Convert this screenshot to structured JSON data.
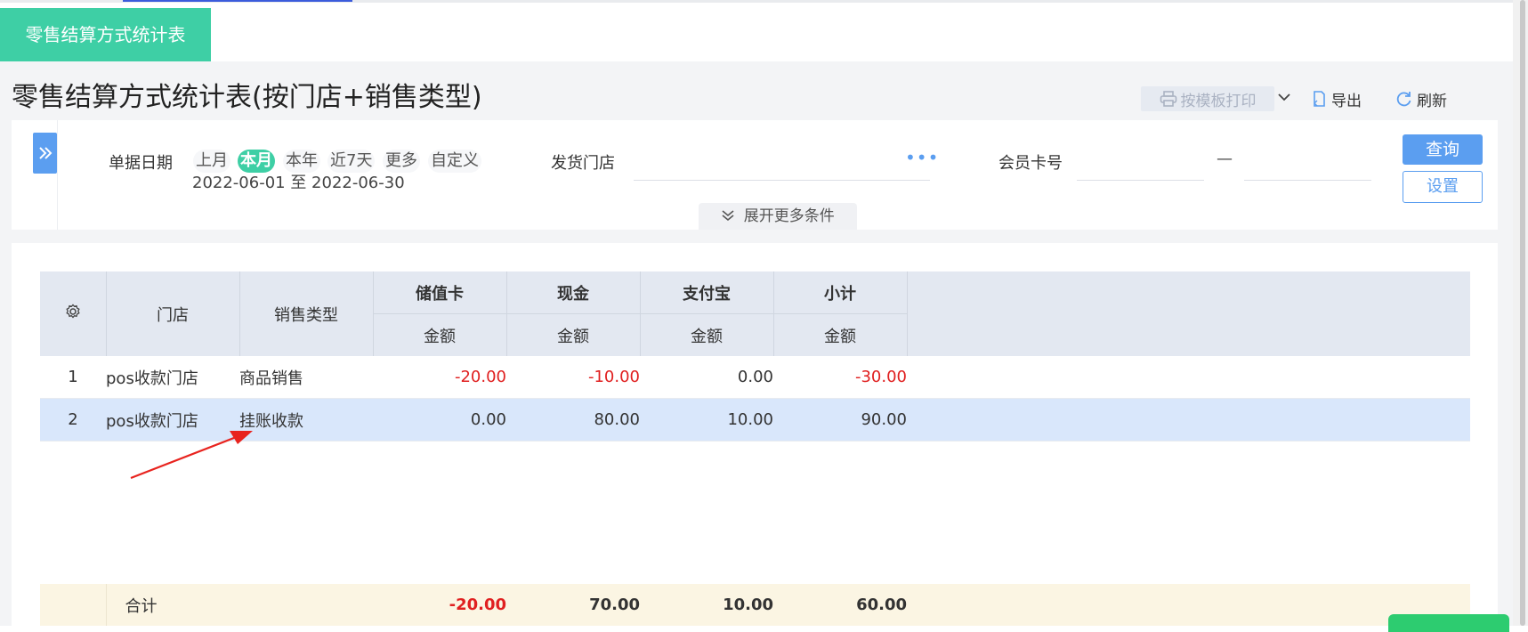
{
  "tabs": [
    {
      "label": "零售结算方式统计表",
      "active": true
    }
  ],
  "page": {
    "title": "零售结算方式统计表(按门店+销售类型)"
  },
  "toolbar": {
    "print_label": "按模板打印",
    "export_label": "导出",
    "refresh_label": "刷新"
  },
  "filters": {
    "date_label": "单据日期",
    "date_options": [
      "上月",
      "本月",
      "本年",
      "近7天",
      "更多",
      "自定义"
    ],
    "date_active": "本月",
    "date_range": "2022-06-01 至 2022-06-30",
    "store_label": "发货门店",
    "store_value": "",
    "card_label": "会员卡号",
    "card_separator": "—",
    "query_label": "查询",
    "settings_label": "设置",
    "expand_label": "展开更多条件"
  },
  "table": {
    "columns": {
      "store": "门店",
      "sale_type": "销售类型"
    },
    "groups": [
      "储值卡",
      "现金",
      "支付宝",
      "小计"
    ],
    "sub_header": "金额",
    "rows": [
      {
        "index": "1",
        "store": "pos收款门店",
        "sale_type": "商品销售",
        "values": [
          "-20.00",
          "-10.00",
          "0.00",
          "-30.00"
        ],
        "selected": false
      },
      {
        "index": "2",
        "store": "pos收款门店",
        "sale_type": "挂账收款",
        "values": [
          "0.00",
          "80.00",
          "10.00",
          "90.00"
        ],
        "selected": true
      }
    ],
    "total": {
      "label": "合计",
      "values": [
        "-20.00",
        "70.00",
        "10.00",
        "60.00"
      ]
    }
  },
  "colors": {
    "accent": "#3ecfa5",
    "primary": "#5b9ef0",
    "negative": "#e02020",
    "annotation_arrow": "#e8231e"
  }
}
